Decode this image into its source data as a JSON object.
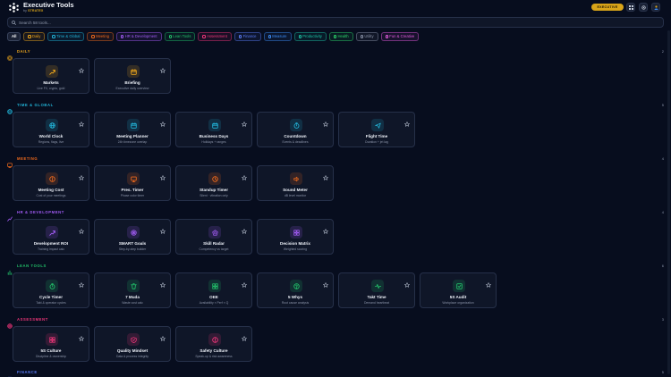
{
  "header": {
    "title": "Executive Tools",
    "subtitle_prefix": "by",
    "brand": "STRATEX",
    "badge": "EXECUTIVE"
  },
  "search": {
    "placeholder": "Search 58 tools..."
  },
  "filters": [
    {
      "label": "All",
      "color": "#ffffff",
      "active": true
    },
    {
      "label": "Daily",
      "color": "#f0a81c"
    },
    {
      "label": "Time & Global",
      "color": "#22b4d8"
    },
    {
      "label": "Meeting",
      "color": "#f06a1c"
    },
    {
      "label": "HR & Development",
      "color": "#a35cf6"
    },
    {
      "label": "Lean Tools",
      "color": "#22c26a"
    },
    {
      "label": "Assessment",
      "color": "#f0367a"
    },
    {
      "label": "Finance",
      "color": "#5a7cf6"
    },
    {
      "label": "Measure",
      "color": "#3c8cf6"
    },
    {
      "label": "Productivity",
      "color": "#1cc4a4"
    },
    {
      "label": "Health",
      "color": "#2cd46a"
    },
    {
      "label": "Utility",
      "color": "#8a93a8"
    },
    {
      "label": "Fun & Creative",
      "color": "#e65ce0"
    }
  ],
  "sections": [
    {
      "title": "DAILY",
      "count": "2",
      "color": "#f0a81c",
      "icon": "sun-icon",
      "tools": [
        {
          "name": "Markets",
          "desc": "Live FX, crypto, gold",
          "icon": "trend-icon"
        },
        {
          "name": "Briefing",
          "desc": "Executive daily overview",
          "icon": "calendar-icon"
        }
      ]
    },
    {
      "title": "TIME & GLOBAL",
      "count": "5",
      "color": "#22b4d8",
      "icon": "globe-icon",
      "tools": [
        {
          "name": "World Clock",
          "desc": "Regions, flags, live",
          "icon": "globe-icon"
        },
        {
          "name": "Meeting Planner",
          "desc": "24h timezone overlap",
          "icon": "calendar-icon"
        },
        {
          "name": "Business Days",
          "desc": "Holidays + ranges",
          "icon": "calendar-icon"
        },
        {
          "name": "Countdown",
          "desc": "Events & deadlines",
          "icon": "stopwatch-icon"
        },
        {
          "name": "Flight Time",
          "desc": "Duration + jet lag",
          "icon": "plane-icon"
        }
      ]
    },
    {
      "title": "MEETING",
      "count": "4",
      "color": "#f06a1c",
      "icon": "meeting-icon",
      "tools": [
        {
          "name": "Meeting Cost",
          "desc": "Cost of your meetings",
          "icon": "dollar-icon"
        },
        {
          "name": "Pres. Timer",
          "desc": "Phase color timer",
          "icon": "presentation-icon"
        },
        {
          "name": "Standup Timer",
          "desc": "Silent · vibration only",
          "icon": "clock-icon"
        },
        {
          "name": "Sound Meter",
          "desc": "dB level monitor",
          "icon": "speaker-icon"
        }
      ]
    },
    {
      "title": "HR & DEVELOPMENT",
      "count": "4",
      "color": "#a35cf6",
      "icon": "growth-icon",
      "tools": [
        {
          "name": "Development ROI",
          "desc": "Training impact calc",
          "icon": "trend-icon"
        },
        {
          "name": "SMART Goals",
          "desc": "Step-by-step builder",
          "icon": "target-icon"
        },
        {
          "name": "Skill Radar",
          "desc": "Competency vs target",
          "icon": "radar-icon"
        },
        {
          "name": "Decision Matrix",
          "desc": "Weighted scoring",
          "icon": "grid-icon"
        }
      ]
    },
    {
      "title": "LEAN TOOLS",
      "count": "6",
      "color": "#22c26a",
      "icon": "chart-icon",
      "tools": [
        {
          "name": "Cycle Timer",
          "desc": "Takt & operator cycles",
          "icon": "stopwatch-icon"
        },
        {
          "name": "7 Muda",
          "desc": "Waste cost calc",
          "icon": "trash-icon"
        },
        {
          "name": "OEE",
          "desc": "Availability × Perf × Q",
          "icon": "grid-icon"
        },
        {
          "name": "5 Whys",
          "desc": "Root cause analysis",
          "icon": "question-icon"
        },
        {
          "name": "Takt Time",
          "desc": "Demand heartbeat",
          "icon": "pulse-icon"
        },
        {
          "name": "5S Audit",
          "desc": "Workplace organization",
          "icon": "checkbox-icon"
        }
      ]
    },
    {
      "title": "ASSESSMENT",
      "count": "3",
      "color": "#f0367a",
      "icon": "target-icon",
      "tools": [
        {
          "name": "5S Culture",
          "desc": "Discipline & ownership",
          "icon": "grid-icon"
        },
        {
          "name": "Quality Mindset",
          "desc": "Data & process integrity",
          "icon": "shield-icon"
        },
        {
          "name": "Safety Culture",
          "desc": "Speak-up & risk awareness",
          "icon": "alert-icon"
        }
      ]
    },
    {
      "title": "FINANCE",
      "count": "5",
      "color": "#5a7cf6",
      "icon": "finance-icon",
      "tools": []
    }
  ]
}
